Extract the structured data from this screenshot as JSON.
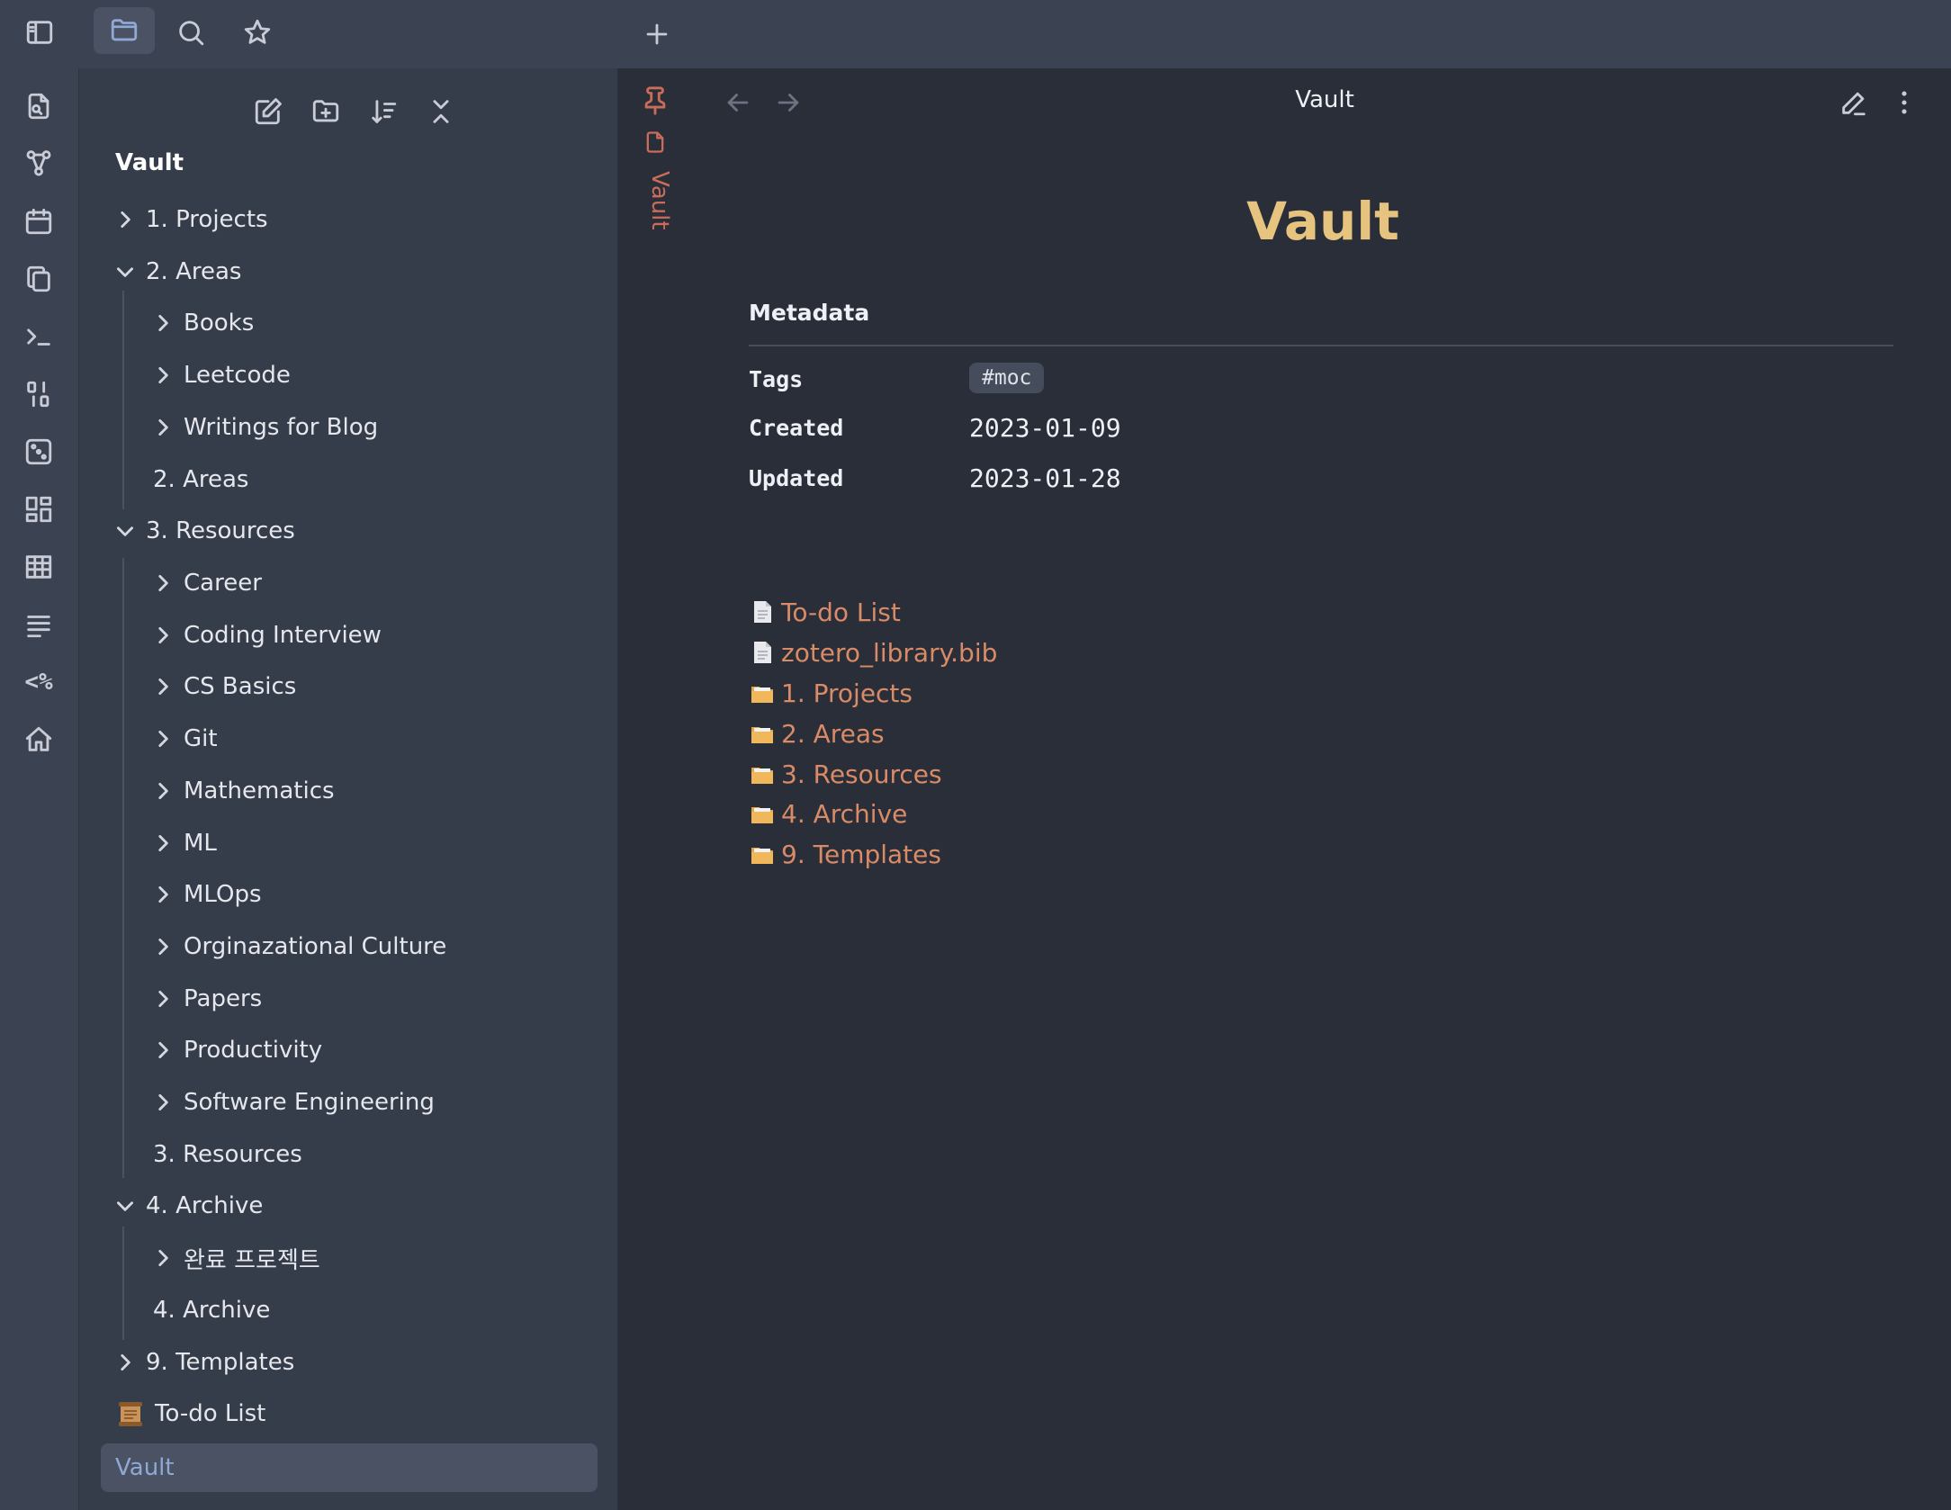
{
  "window": {
    "active_tab_title": "Vault"
  },
  "sidebar": {
    "root_label": "Vault",
    "tree": [
      {
        "label": "1. Projects",
        "expanded": false
      },
      {
        "label": "2. Areas",
        "expanded": true
      },
      {
        "label": "Books",
        "expanded": false
      },
      {
        "label": "Leetcode",
        "expanded": false
      },
      {
        "label": "Writings for Blog",
        "expanded": false
      },
      {
        "label": "2. Areas",
        "expanded": null
      },
      {
        "label": "3. Resources",
        "expanded": true
      },
      {
        "label": "Career",
        "expanded": false
      },
      {
        "label": "Coding Interview",
        "expanded": false
      },
      {
        "label": "CS Basics",
        "expanded": false
      },
      {
        "label": "Git",
        "expanded": false
      },
      {
        "label": "Mathematics",
        "expanded": false
      },
      {
        "label": "ML",
        "expanded": false
      },
      {
        "label": "MLOps",
        "expanded": false
      },
      {
        "label": "Orginazational Culture",
        "expanded": false
      },
      {
        "label": "Papers",
        "expanded": false
      },
      {
        "label": "Productivity",
        "expanded": false
      },
      {
        "label": "Software Engineering",
        "expanded": false
      },
      {
        "label": "3. Resources",
        "expanded": null
      },
      {
        "label": "4. Archive",
        "expanded": true
      },
      {
        "label": "완료 프로젝트",
        "expanded": false
      },
      {
        "label": "4. Archive",
        "expanded": null
      },
      {
        "label": "9. Templates",
        "expanded": false
      },
      {
        "label": "To-do List",
        "expanded": null
      },
      {
        "label": "Vault",
        "expanded": null
      }
    ]
  },
  "pane": {
    "pinned_label": "Vault"
  },
  "note": {
    "title": "Vault",
    "metadata_heading": "Metadata",
    "metadata": {
      "tags_key": "Tags",
      "tags_value": "#moc",
      "created_key": "Created",
      "created_value": "2023-01-09",
      "updated_key": "Updated",
      "updated_value": "2023-01-28"
    },
    "links": [
      {
        "icon": "page-facing-up-icon",
        "label": "To-do List"
      },
      {
        "icon": "page-facing-up-icon",
        "label": "zotero_library.bib"
      },
      {
        "icon": "file-folder-icon",
        "label": "1. Projects"
      },
      {
        "icon": "file-folder-icon",
        "label": "2. Areas"
      },
      {
        "icon": "file-folder-icon",
        "label": "3. Resources"
      },
      {
        "icon": "file-folder-icon",
        "label": "4. Archive"
      },
      {
        "icon": "file-folder-icon",
        "label": "9. Templates"
      }
    ]
  },
  "colors": {
    "accent_title": "#e6c37f",
    "link": "#d88b66",
    "selected_text": "#8fa9d4",
    "pin": "#c96d5a"
  }
}
